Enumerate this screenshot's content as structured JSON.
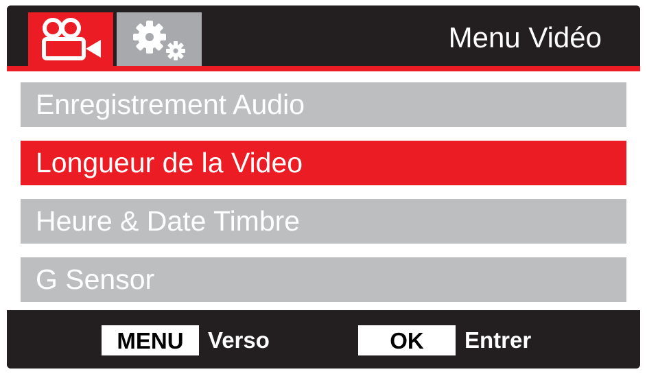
{
  "header": {
    "title": "Menu Vidéo",
    "tabs": [
      {
        "id": "video",
        "icon": "video-camera-icon",
        "selected": true
      },
      {
        "id": "settings",
        "icon": "gears-icon",
        "selected": false
      }
    ]
  },
  "menu": {
    "items": [
      {
        "label": "Enregistrement Audio",
        "selected": false
      },
      {
        "label": "Longueur de la Video",
        "selected": true
      },
      {
        "label": "Heure & Date Timbre",
        "selected": false
      },
      {
        "label": "G Sensor",
        "selected": false
      }
    ]
  },
  "footer": {
    "menu_key": "MENU",
    "menu_action": "Verso",
    "ok_key": "OK",
    "ok_action": "Entrer"
  },
  "colors": {
    "accent": "#ec1c24",
    "background": "#231f20",
    "inactive_item": "#bcbec0",
    "inactive_tab": "#a7a9ac",
    "text": "#ffffff"
  }
}
